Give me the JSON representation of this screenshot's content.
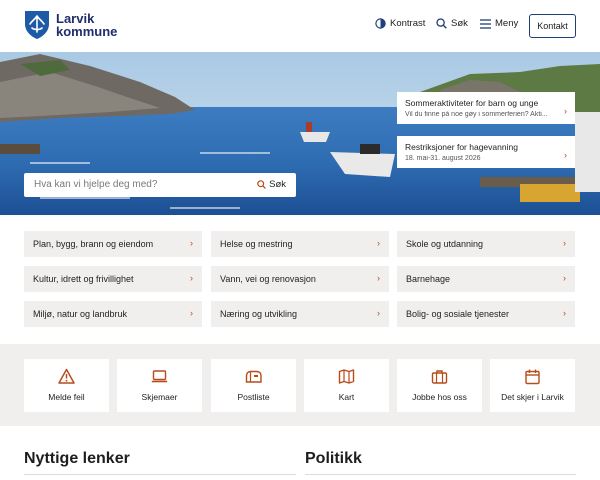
{
  "header": {
    "logo_line1": "Larvik",
    "logo_line2": "kommune",
    "contrast_label": "Kontrast",
    "search_label": "Søk",
    "menu_label": "Meny",
    "contact_label": "Kontakt"
  },
  "hero": {
    "search_placeholder": "Hva kan vi hjelpe deg med?",
    "search_button": "Søk",
    "news": [
      {
        "title": "Sommeraktiviteter for barn og unge",
        "subtitle": "Vil du finne på noe gøy i sommerferien? Akti..."
      },
      {
        "title": "Restriksjoner for hagevanning",
        "subtitle": "18. mai-31. august 2026"
      }
    ]
  },
  "categories": [
    "Plan, bygg, brann og eiendom",
    "Helse og mestring",
    "Skole og utdanning",
    "Kultur, idrett og frivillighet",
    "Vann, vei og renovasjon",
    "Barnehage",
    "Miljø, natur og landbruk",
    "Næring og utvikling",
    "Bolig- og sosiale tjenester"
  ],
  "quick_links": [
    {
      "label": "Melde feil",
      "icon": "warning-icon"
    },
    {
      "label": "Skjemaer",
      "icon": "laptop-icon"
    },
    {
      "label": "Postliste",
      "icon": "mailbox-icon"
    },
    {
      "label": "Kart",
      "icon": "map-icon"
    },
    {
      "label": "Jobbe hos oss",
      "icon": "briefcase-icon"
    },
    {
      "label": "Det skjer i Larvik",
      "icon": "calendar-icon"
    }
  ],
  "sections": {
    "useful_links": "Nyttige lenker",
    "politics": "Politikk"
  },
  "colors": {
    "brand": "#1f2d6b",
    "accent": "#b84b1a",
    "tile_background": "#f0efed"
  }
}
